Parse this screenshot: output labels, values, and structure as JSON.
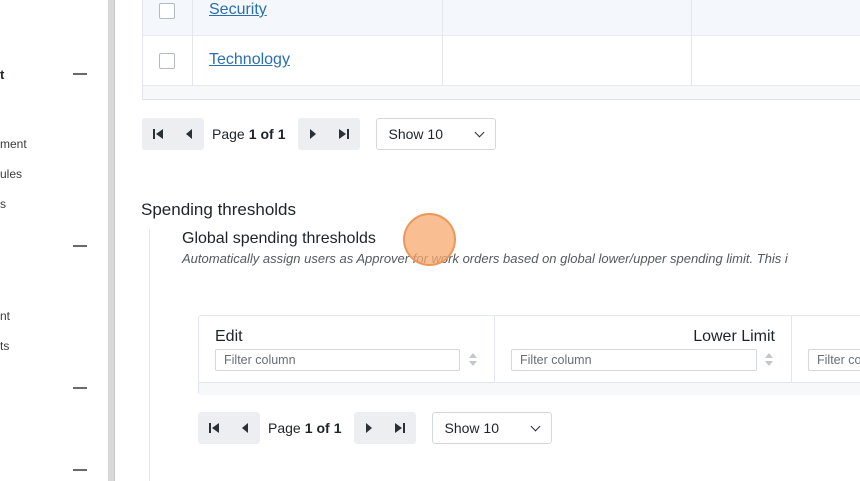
{
  "sidebar": {
    "heading": "t",
    "items": [
      {
        "label": "ment"
      },
      {
        "label": "ules"
      },
      {
        "label": "s"
      },
      {
        "label": "nt"
      },
      {
        "label": "ts"
      }
    ]
  },
  "categories": {
    "rows": [
      {
        "name": "Security"
      },
      {
        "name": "Technology"
      }
    ],
    "pager": {
      "page_word": "Page",
      "current": "1",
      "of_word": "of",
      "total": "1",
      "show_label": "Show 10"
    }
  },
  "spending": {
    "section_title": "Spending thresholds",
    "global_title": "Global spending thresholds",
    "global_desc": "Automatically assign users as Approver for work orders based on global lower/upper spending limit. This i",
    "columns": [
      {
        "label": "Edit",
        "filter_placeholder": "Filter column"
      },
      {
        "label": "Lower Limit",
        "filter_placeholder": "Filter column"
      },
      {
        "label": "",
        "filter_placeholder": "Filter co"
      }
    ],
    "pager": {
      "page_word": "Page",
      "current": "1",
      "of_word": "of",
      "total": "1",
      "show_label": "Show 10"
    }
  },
  "colors": {
    "link": "#2a6fb0",
    "click_indicator": "#f7aa6e"
  }
}
